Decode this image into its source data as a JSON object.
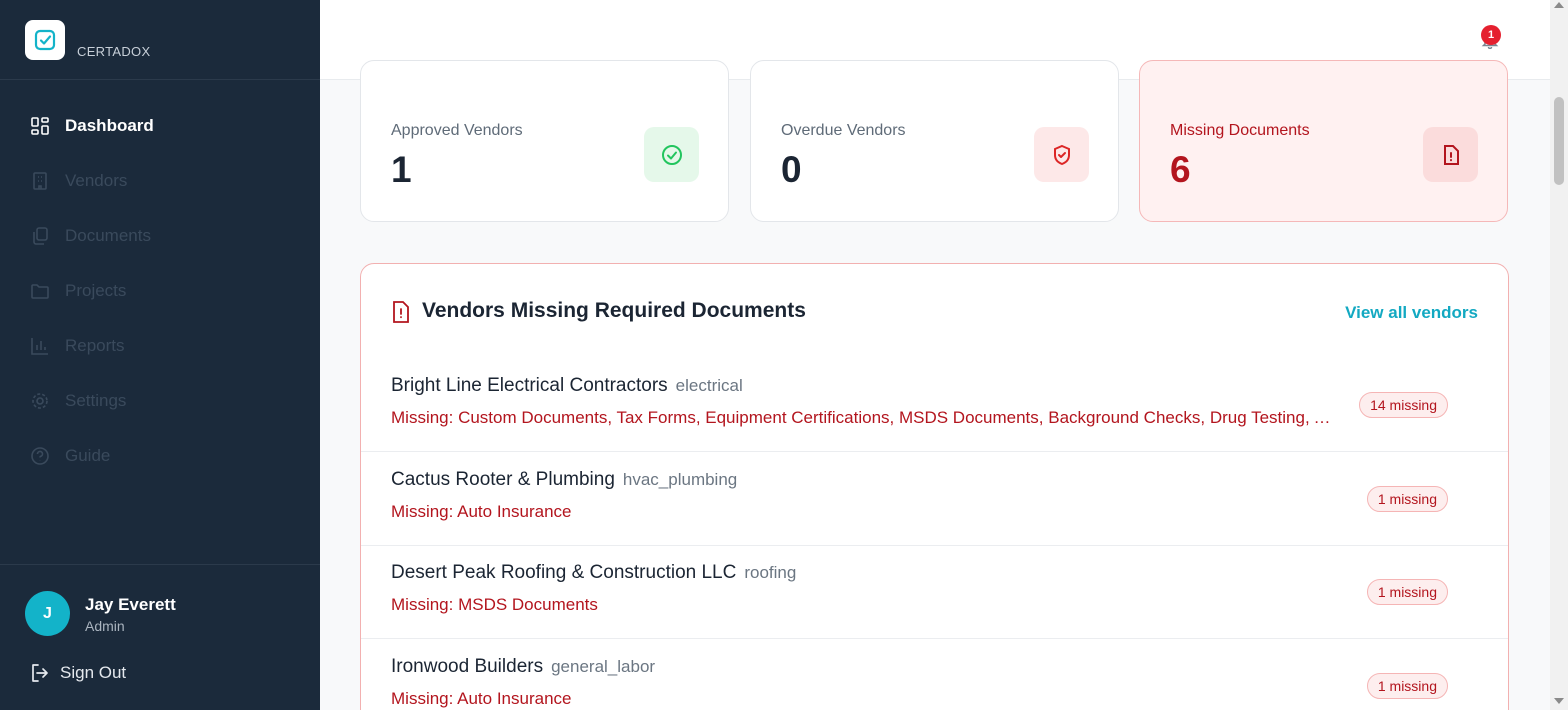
{
  "brand": {
    "name": "CERTADOX",
    "logo_icon": "check-square-icon",
    "accent": "#13b3c9"
  },
  "sidebar": {
    "items": [
      {
        "label": "Dashboard",
        "icon": "grid-icon",
        "active": true
      },
      {
        "label": "Vendors",
        "icon": "building-icon",
        "active": false
      },
      {
        "label": "Documents",
        "icon": "documents-icon",
        "active": false
      },
      {
        "label": "Projects",
        "icon": "folder-icon",
        "active": false
      },
      {
        "label": "Reports",
        "icon": "bar-chart-icon",
        "active": false
      },
      {
        "label": "Settings",
        "icon": "gear-icon",
        "active": false
      },
      {
        "label": "Guide",
        "icon": "help-circle-icon",
        "active": false
      }
    ],
    "user": {
      "initial": "J",
      "name": "Jay Everett",
      "role": "Admin"
    },
    "sign_out": "Sign Out"
  },
  "header": {
    "notifications_count": "1"
  },
  "stats": [
    {
      "label": "Approved Vendors",
      "value": "1",
      "icon": "check-circle-icon",
      "color": "#22c55e"
    },
    {
      "label": "Overdue Vendors",
      "value": "0",
      "icon": "shield-icon",
      "color": "#dc2626"
    },
    {
      "label": "Missing Documents",
      "value": "6",
      "icon": "file-alert-icon",
      "color": "#b3151e"
    }
  ],
  "missing_panel": {
    "title": "Vendors Missing Required Documents",
    "view_all": "View all vendors",
    "vendors": [
      {
        "name": "Bright Line Electrical Contractors",
        "category": "electrical",
        "missing": "Missing: Custom Documents, Tax Forms, Equipment Certifications, MSDS Documents, Background Checks, Drug Testing, Auto Insurance, Workers Comp",
        "badge": "14 missing"
      },
      {
        "name": "Cactus Rooter & Plumbing",
        "category": "hvac_plumbing",
        "missing": "Missing: Auto Insurance",
        "badge": "1 missing"
      },
      {
        "name": "Desert Peak Roofing & Construction LLC",
        "category": "roofing",
        "missing": "Missing: MSDS Documents",
        "badge": "1 missing"
      },
      {
        "name": "Ironwood Builders",
        "category": "general_labor",
        "missing": "Missing: Auto Insurance",
        "badge": "1 missing"
      }
    ]
  }
}
